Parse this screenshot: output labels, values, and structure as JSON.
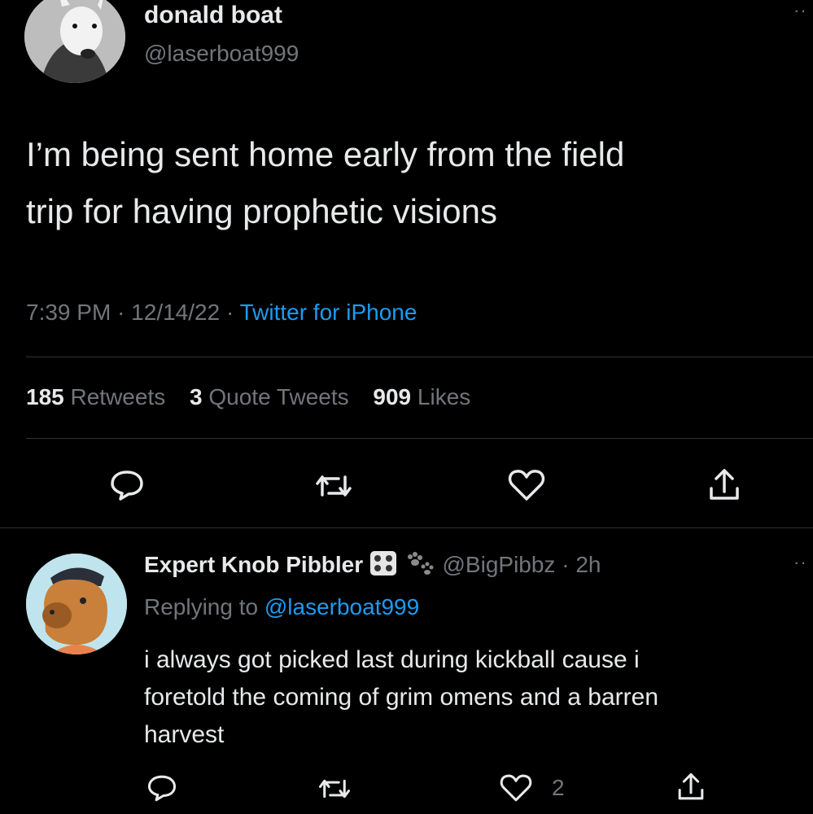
{
  "tweet": {
    "author": {
      "display_name": "donald boat",
      "handle": "@laserboat999"
    },
    "text_line1": "I’m being sent home early from the field",
    "text_line2": "trip for having prophetic visions",
    "time": "7:39 PM",
    "date": "12/14/22",
    "separator": "·",
    "source": "Twitter for iPhone",
    "stats": {
      "retweets_count": "185",
      "retweets_label": "Retweets",
      "quotes_count": "3",
      "quotes_label": "Quote Tweets",
      "likes_count": "909",
      "likes_label": "Likes"
    },
    "actions": [
      "reply-icon",
      "retweet-icon",
      "like-icon",
      "share-icon"
    ]
  },
  "reply": {
    "author": {
      "display_name": "Expert Knob Pibbler",
      "handle": "@BigPibbz",
      "time_ago": "2h"
    },
    "replying_prefix": "Replying to",
    "replying_handle": "@laserboat999",
    "text_line1": "i always got picked last during kickball cause i",
    "text_line2": "foretold the coming of grim omens and a barren",
    "text_line3": "harvest",
    "like_count": "2",
    "actions": [
      "reply-icon",
      "retweet-icon",
      "like-icon",
      "share-icon"
    ]
  },
  "colors": {
    "background": "#000000",
    "text": "#e7e9ea",
    "muted": "#71767b",
    "link": "#1d9bf0",
    "divider": "#2f3336"
  }
}
